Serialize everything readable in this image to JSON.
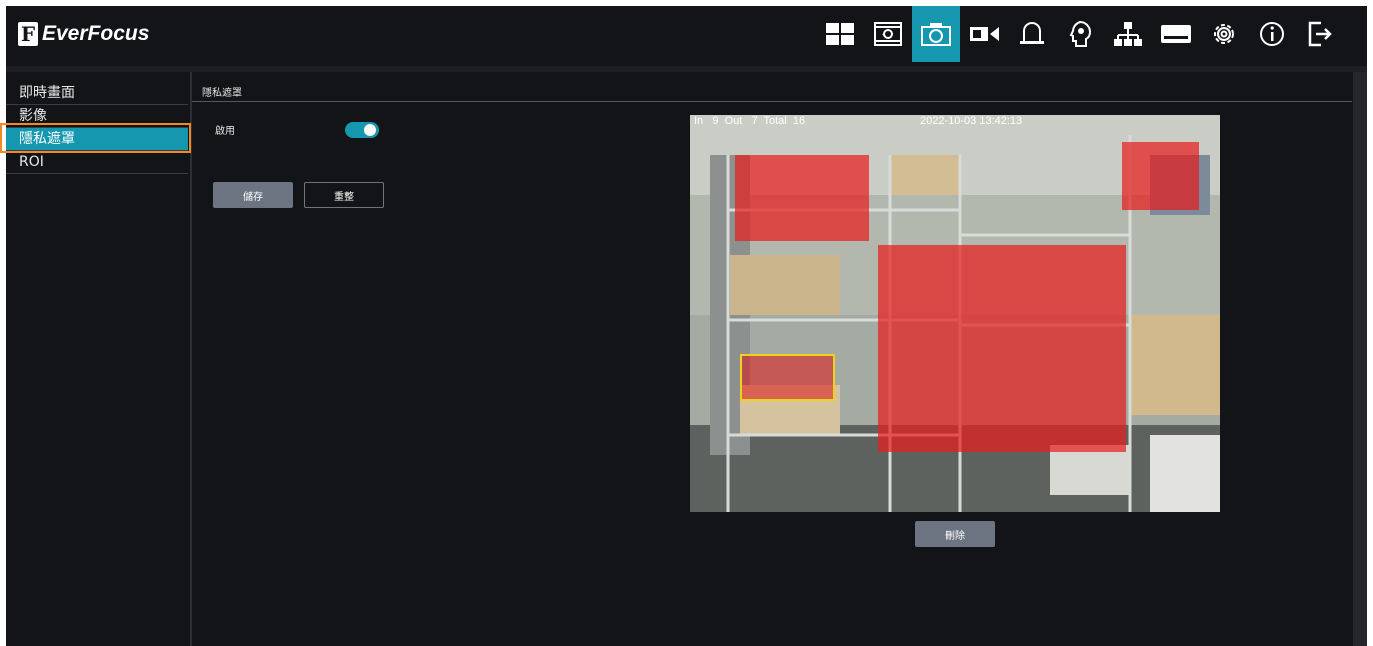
{
  "header": {
    "brand": "EverFocus",
    "brand_mark": "F",
    "toolbar": [
      {
        "icon": "layout-grid-icon",
        "active": false
      },
      {
        "icon": "playback-icon",
        "active": false
      },
      {
        "icon": "camera-icon",
        "active": true
      },
      {
        "icon": "video-record-icon",
        "active": false
      },
      {
        "icon": "alarm-bell-icon",
        "active": false
      },
      {
        "icon": "ai-analytics-icon",
        "active": false
      },
      {
        "icon": "network-icon",
        "active": false
      },
      {
        "icon": "storage-icon",
        "active": false
      },
      {
        "icon": "settings-gear-icon",
        "active": false
      },
      {
        "icon": "info-icon",
        "active": false
      },
      {
        "icon": "logout-icon",
        "active": false
      }
    ],
    "accent_color": "#1597b0"
  },
  "sidebar": {
    "items": [
      {
        "label": "即時畫面",
        "active": false
      },
      {
        "label": "影像",
        "active": false
      },
      {
        "label": "隱私遮罩",
        "active": true
      },
      {
        "label": "ROI",
        "active": false
      }
    ],
    "highlight_color": "#f08a24"
  },
  "main": {
    "title": "隱私遮罩",
    "enable_label": "啟用",
    "enable_on": true,
    "save_label": "儲存",
    "reset_label": "重整",
    "delete_label": "刪除",
    "video": {
      "osd_counts": "In   9  Out   7  Total  16",
      "osd_timestamp": "2022-10-03 13:42:13",
      "mask_count": 4,
      "mask_color": "#e61e1e",
      "selected_mask_border": "#f0d21a"
    }
  }
}
